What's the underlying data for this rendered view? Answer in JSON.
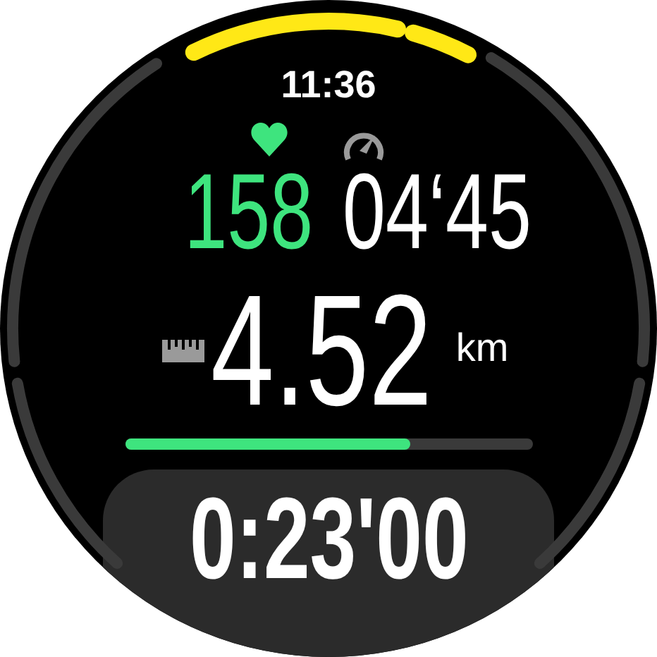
{
  "time": "11:36",
  "heart_rate": {
    "value": "158"
  },
  "pace": {
    "value": "04‘45"
  },
  "distance": {
    "value": "4.52",
    "unit": "km"
  },
  "progress": {
    "level": 0.7
  },
  "duration": "0:23'00"
}
